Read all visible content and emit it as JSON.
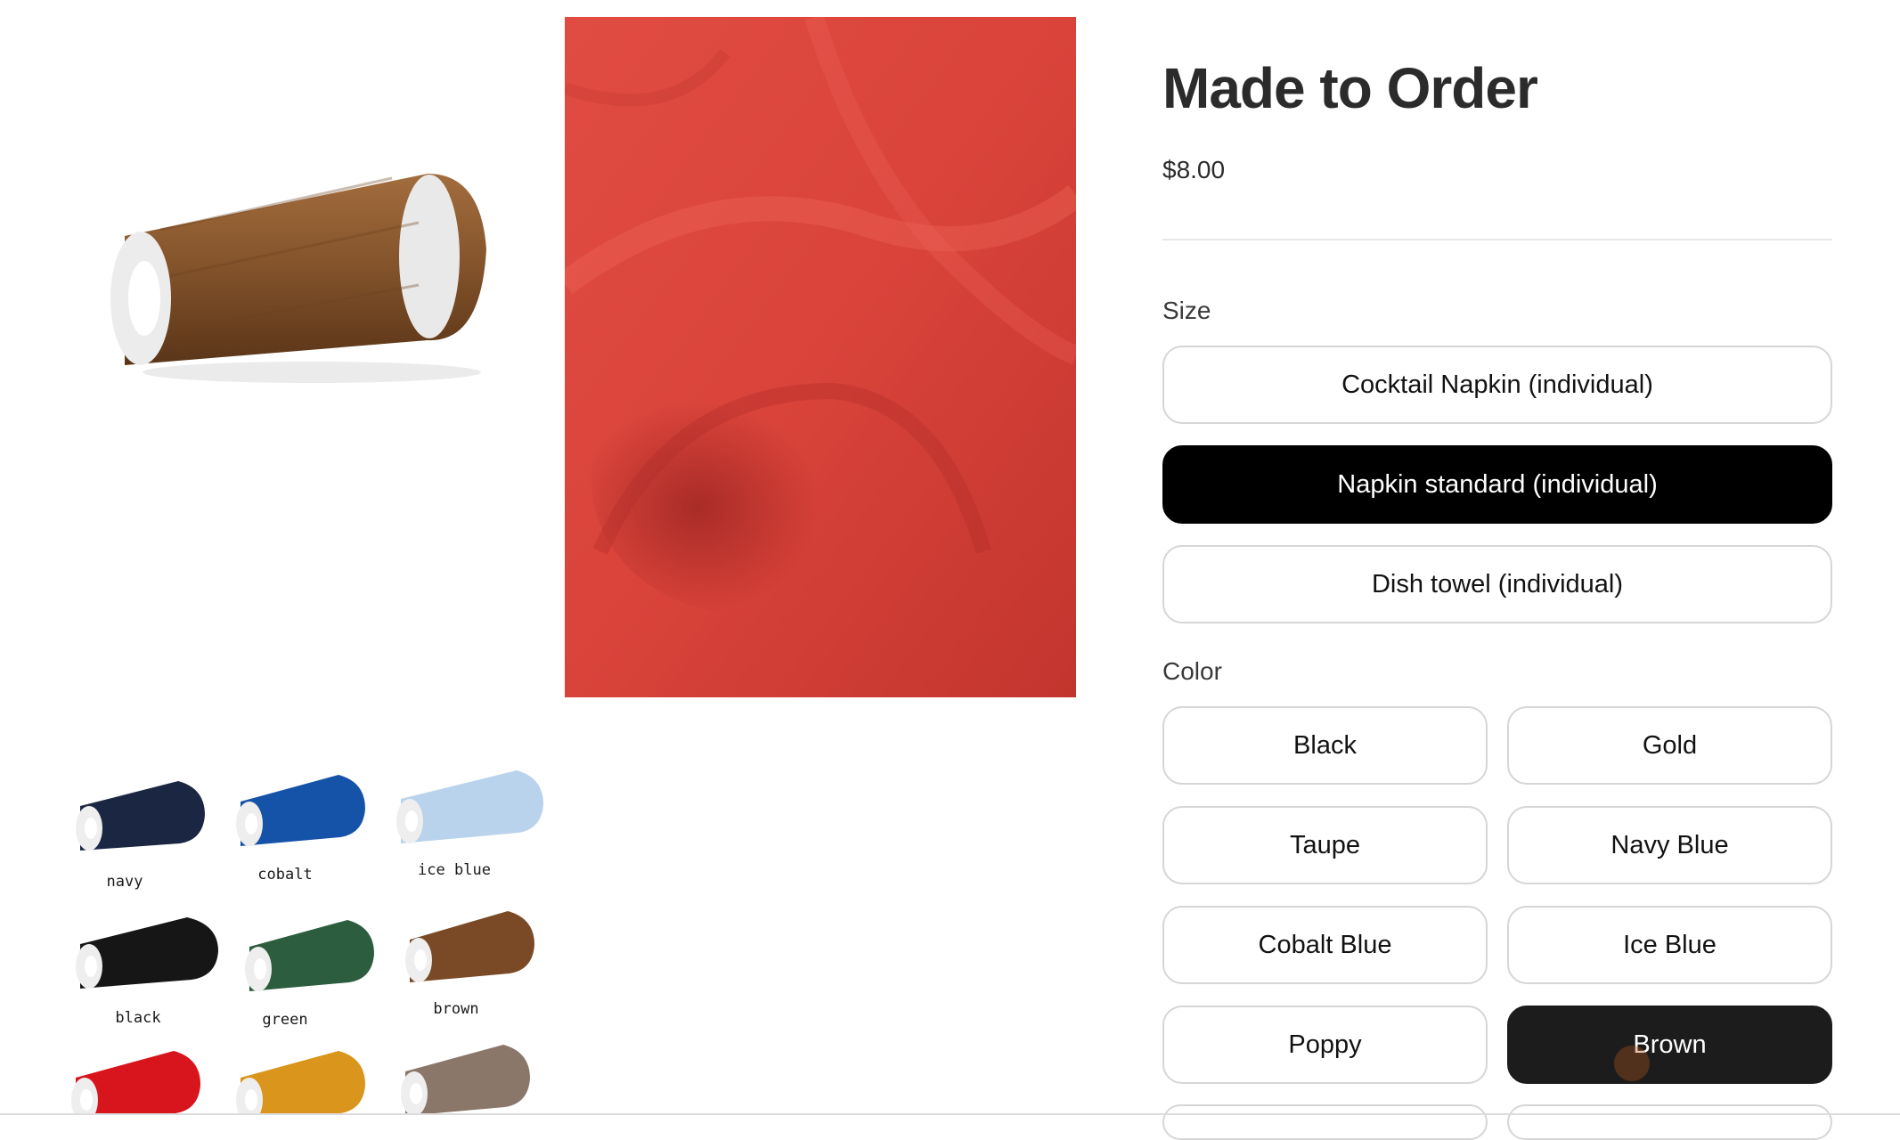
{
  "product": {
    "title": "Made to Order",
    "price": "$8.00"
  },
  "size": {
    "label": "Size",
    "options": [
      "Cocktail Napkin (individual)",
      "Napkin standard (individual)",
      "Dish towel (individual)"
    ],
    "selected": "Napkin standard (individual)"
  },
  "color": {
    "label": "Color",
    "options": [
      "Black",
      "Gold",
      "Taupe",
      "Navy Blue",
      "Cobalt Blue",
      "Ice Blue",
      "Poppy",
      "Brown"
    ],
    "selected": "Brown"
  },
  "thread_swatches": {
    "labels": [
      "navy",
      "cobalt",
      "ice blue",
      "black",
      "green",
      "brown"
    ],
    "colors": {
      "navy": "#1b2742",
      "cobalt": "#1553a8",
      "ice_blue": "#b9d3ec",
      "black": "#161616",
      "green": "#2c5d3f",
      "brown": "#7a4a26",
      "red": "#d8141c",
      "gold": "#d9951c",
      "taupe": "#8a7769"
    }
  },
  "images": {
    "main_spool_color": "#86552c",
    "fabric_color": "#d9433a"
  }
}
